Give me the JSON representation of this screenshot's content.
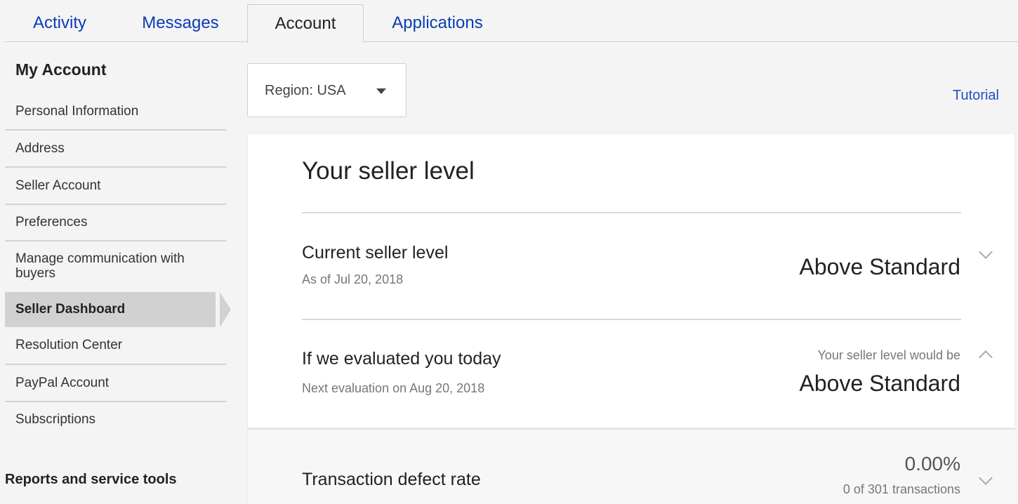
{
  "tabs": [
    {
      "label": "Activity",
      "active": false
    },
    {
      "label": "Messages",
      "active": false
    },
    {
      "label": "Account",
      "active": true
    },
    {
      "label": "Applications",
      "active": false
    }
  ],
  "sidebar": {
    "title": "My Account",
    "items": [
      {
        "label": "Personal Information"
      },
      {
        "label": "Address"
      },
      {
        "label": "Seller Account"
      },
      {
        "label": "Preferences"
      },
      {
        "label": "Manage communication with buyers"
      },
      {
        "label": "Seller Dashboard",
        "active": true
      },
      {
        "label": "Resolution Center"
      },
      {
        "label": "PayPal Account"
      },
      {
        "label": "Subscriptions"
      }
    ],
    "section_title": "Reports and service tools"
  },
  "region": {
    "label": "Region: USA",
    "icon": "caret-down-icon"
  },
  "tutorial_link": "Tutorial",
  "seller_level": {
    "title": "Your seller level",
    "current": {
      "title": "Current seller level",
      "subtitle": "As of Jul 20, 2018",
      "value": "Above Standard",
      "icon": "chevron-down-icon"
    },
    "today": {
      "title": "If we evaluated you today",
      "subtitle": "Next evaluation on Aug 20, 2018",
      "hint": "Your seller level would be",
      "value": "Above Standard",
      "icon": "chevron-up-icon"
    }
  },
  "metrics": {
    "defect_rate": {
      "title": "Transaction defect rate",
      "value": "0.00%",
      "detail": "0 of 301 transactions",
      "icon": "chevron-down-icon"
    }
  },
  "colors": {
    "link": "#0b3bb5",
    "active_item_bg": "#d1d1d1",
    "page_bg": "#f4f4f4"
  }
}
